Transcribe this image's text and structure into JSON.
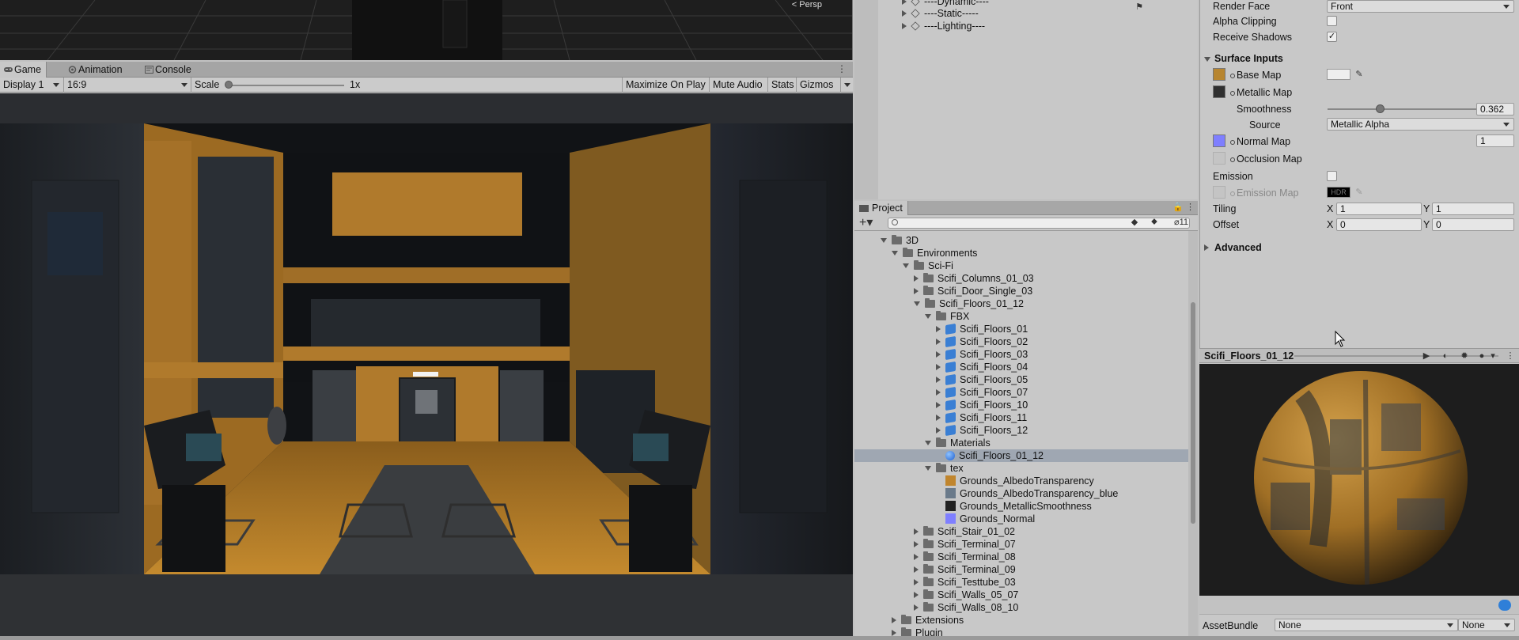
{
  "scene": {
    "persp_label": "< Persp"
  },
  "game_tabs": [
    {
      "label": "Game",
      "icon": "gamepad-icon"
    },
    {
      "label": "Animation",
      "icon": "animation-icon"
    },
    {
      "label": "Console",
      "icon": "console-icon"
    }
  ],
  "game_toolbar": {
    "display": "Display 1",
    "aspect": "16:9",
    "scale_label": "Scale",
    "scale_value": "1x",
    "scale_fraction": 0.0,
    "maximize": "Maximize On Play",
    "mute": "Mute Audio",
    "stats": "Stats",
    "gizmos": "Gizmos"
  },
  "hierarchy": {
    "items": [
      {
        "label": "----Dynamic----"
      },
      {
        "label": "----Static-----"
      },
      {
        "label": "----Lighting----"
      }
    ]
  },
  "project": {
    "tab": "Project",
    "hidden_count": "11",
    "search_placeholder": "",
    "tree": [
      {
        "label": "3D",
        "kind": "folder",
        "open": true,
        "depth": 2
      },
      {
        "label": "Environments",
        "kind": "folder",
        "open": true,
        "depth": 3
      },
      {
        "label": "Sci-Fi",
        "kind": "folder",
        "open": true,
        "depth": 4
      },
      {
        "label": "Scifi_Columns_01_03",
        "kind": "folder",
        "open": false,
        "depth": 5
      },
      {
        "label": "Scifi_Door_Single_03",
        "kind": "folder",
        "open": false,
        "depth": 5
      },
      {
        "label": "Scifi_Floors_01_12",
        "kind": "folder",
        "open": true,
        "depth": 5
      },
      {
        "label": "FBX",
        "kind": "folder",
        "open": true,
        "depth": 6
      },
      {
        "label": "Scifi_Floors_01",
        "kind": "mesh",
        "open": false,
        "depth": 7
      },
      {
        "label": "Scifi_Floors_02",
        "kind": "mesh",
        "open": false,
        "depth": 7
      },
      {
        "label": "Scifi_Floors_03",
        "kind": "mesh",
        "open": false,
        "depth": 7
      },
      {
        "label": "Scifi_Floors_04",
        "kind": "mesh",
        "open": false,
        "depth": 7
      },
      {
        "label": "Scifi_Floors_05",
        "kind": "mesh",
        "open": false,
        "depth": 7
      },
      {
        "label": "Scifi_Floors_07",
        "kind": "mesh",
        "open": false,
        "depth": 7
      },
      {
        "label": "Scifi_Floors_10",
        "kind": "mesh",
        "open": false,
        "depth": 7
      },
      {
        "label": "Scifi_Floors_11",
        "kind": "mesh",
        "open": false,
        "depth": 7
      },
      {
        "label": "Scifi_Floors_12",
        "kind": "mesh",
        "open": false,
        "depth": 7
      },
      {
        "label": "Materials",
        "kind": "folder",
        "open": true,
        "depth": 6
      },
      {
        "label": "Scifi_Floors_01_12",
        "kind": "material",
        "depth": 7,
        "selected": true
      },
      {
        "label": "tex",
        "kind": "folder",
        "open": true,
        "depth": 6
      },
      {
        "label": "Grounds_AlbedoTransparency",
        "kind": "tex-albedo",
        "depth": 7
      },
      {
        "label": "Grounds_AlbedoTransparency_blue",
        "kind": "tex-blue",
        "depth": 7
      },
      {
        "label": "Grounds_MetallicSmoothness",
        "kind": "tex-metal",
        "depth": 7
      },
      {
        "label": "Grounds_Normal",
        "kind": "tex-normal",
        "depth": 7
      },
      {
        "label": "Scifi_Stair_01_02",
        "kind": "folder",
        "open": false,
        "depth": 5
      },
      {
        "label": "Scifi_Terminal_07",
        "kind": "folder",
        "open": false,
        "depth": 5
      },
      {
        "label": "Scifi_Terminal_08",
        "kind": "folder",
        "open": false,
        "depth": 5
      },
      {
        "label": "Scifi_Terminal_09",
        "kind": "folder",
        "open": false,
        "depth": 5
      },
      {
        "label": "Scifi_Testtube_03",
        "kind": "folder",
        "open": false,
        "depth": 5
      },
      {
        "label": "Scifi_Walls_05_07",
        "kind": "folder",
        "open": false,
        "depth": 5
      },
      {
        "label": "Scifi_Walls_08_10",
        "kind": "folder",
        "open": false,
        "depth": 5
      },
      {
        "label": "Extensions",
        "kind": "folder",
        "open": false,
        "depth": 3
      },
      {
        "label": "Plugin",
        "kind": "folder",
        "open": false,
        "depth": 3
      }
    ]
  },
  "inspector": {
    "render_face_label": "Render Face",
    "render_face_value": "Front",
    "alpha_clipping_label": "Alpha Clipping",
    "alpha_clipping_checked": false,
    "receive_shadows_label": "Receive Shadows",
    "receive_shadows_checked": true,
    "surface_inputs_label": "Surface Inputs",
    "base_map_label": "Base Map",
    "metallic_map_label": "Metallic Map",
    "smoothness_label": "Smoothness",
    "smoothness_value": "0.362",
    "source_label": "Source",
    "source_value": "Metallic Alpha",
    "normal_map_label": "Normal Map",
    "normal_map_value": "1",
    "occlusion_map_label": "Occlusion Map",
    "emission_label": "Emission",
    "emission_checked": false,
    "emission_map_label": "Emission Map",
    "hdr_label": "HDR",
    "tiling_label": "Tiling",
    "offset_label": "Offset",
    "x_label": "X",
    "y_label": "Y",
    "tiling_x": "1",
    "tiling_y": "1",
    "offset_x": "0",
    "offset_y": "0",
    "advanced_label": "Advanced",
    "check_mark": "✓"
  },
  "preview": {
    "title": "Scifi_Floors_01_12"
  },
  "assetbundle": {
    "label": "AssetBundle",
    "name_value": "None",
    "variant_value": "None"
  },
  "colors": {
    "accent_blue": "#2f7fd8",
    "selection": "#9fa7b2",
    "panel": "#c8c8c8",
    "floor_orange": "#b27a26",
    "normal_map_swatch": "#7f7fff"
  }
}
